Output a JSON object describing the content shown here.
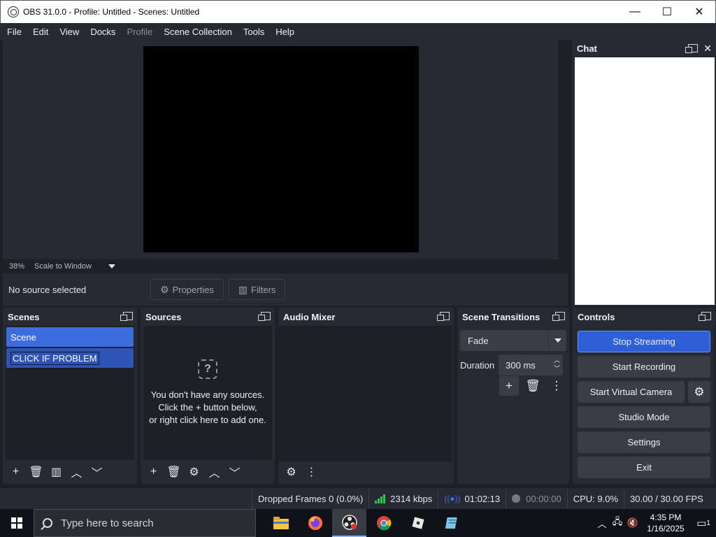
{
  "window": {
    "title": "OBS 31.0.0 - Profile: Untitled - Scenes: Untitled",
    "minimize": "—",
    "maximize": "☐",
    "close": "✕"
  },
  "menu": [
    "File",
    "Edit",
    "View",
    "Docks",
    "Profile",
    "Scene Collection",
    "Tools",
    "Help"
  ],
  "preview": {
    "zoom": "38%",
    "scale_mode": "Scale to Window"
  },
  "source_toolbar": {
    "no_source": "No source selected",
    "properties": "Properties",
    "filters": "Filters"
  },
  "chat": {
    "title": "Chat"
  },
  "scenes": {
    "title": "Scenes",
    "items": [
      "Scene",
      "CLICK IF PROBLEM"
    ]
  },
  "sources": {
    "title": "Sources",
    "empty_line1": "You don't have any sources.",
    "empty_line2": "Click the + button below,",
    "empty_line3": "or right click here to add one."
  },
  "audio_mixer": {
    "title": "Audio Mixer"
  },
  "transitions": {
    "title": "Scene Transitions",
    "selected": "Fade",
    "duration_label": "Duration",
    "duration_value": "300 ms"
  },
  "controls": {
    "title": "Controls",
    "stop_streaming": "Stop Streaming",
    "start_recording": "Start Recording",
    "start_virtual_camera": "Start Virtual Camera",
    "studio_mode": "Studio Mode",
    "settings": "Settings",
    "exit": "Exit"
  },
  "status": {
    "dropped_frames": "Dropped Frames 0 (0.0%)",
    "bitrate": "2314 kbps",
    "stream_time": "01:02:13",
    "record_time": "00:00:00",
    "cpu": "CPU: 9.0%",
    "fps": "30.00 / 30.00 FPS"
  },
  "taskbar": {
    "search_placeholder": "Type here to search",
    "time": "4:35 PM",
    "date": "1/16/2025",
    "notification_count": "1"
  },
  "colors": {
    "accent": "#3b6ddc",
    "stream_button": "#2f5fd8",
    "bitrate_indicator": "#2bc84a"
  }
}
